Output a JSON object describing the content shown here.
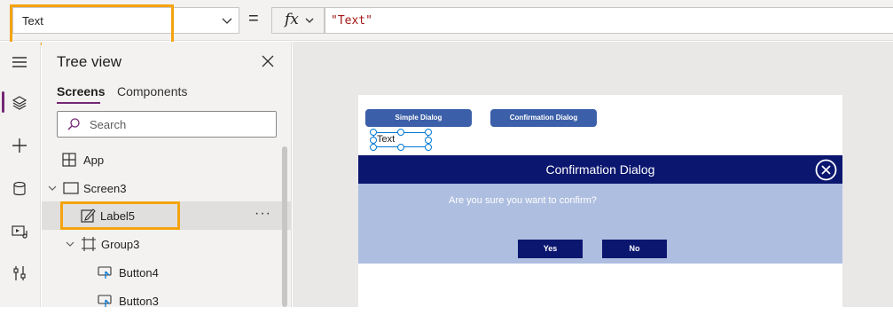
{
  "formula_bar": {
    "property": "Text",
    "equals": "=",
    "fx_label": "fx",
    "formula": "\"Text\""
  },
  "rail": {
    "icons": [
      "hamburger-icon",
      "layers-icon",
      "plus-icon",
      "database-icon",
      "media-icon",
      "tools-icon"
    ]
  },
  "tree": {
    "title": "Tree view",
    "tabs": [
      "Screens",
      "Components"
    ],
    "search_placeholder": "Search",
    "items": [
      {
        "label": "App",
        "icon": "app-icon"
      },
      {
        "label": "Screen3",
        "icon": "screen-icon"
      },
      {
        "label": "Label5",
        "icon": "label-edit-icon",
        "selected": true
      },
      {
        "label": "Group3",
        "icon": "group-icon"
      },
      {
        "label": "Button4",
        "icon": "button-icon"
      },
      {
        "label": "Button3",
        "icon": "button-icon"
      }
    ],
    "more": "···"
  },
  "canvas": {
    "buttons": [
      "Simple Dialog",
      "Confirmation Dialog"
    ],
    "label_text": "Text",
    "dialog": {
      "title": "Confirmation Dialog",
      "message": "Are you sure you want to confirm?",
      "yes": "Yes",
      "no": "No"
    }
  },
  "colors": {
    "highlight": "#f4a30f",
    "accent": "#742774",
    "dialog_header": "#0b166f",
    "dialog_body": "#aebee0",
    "app_button": "#3b5fa8"
  }
}
